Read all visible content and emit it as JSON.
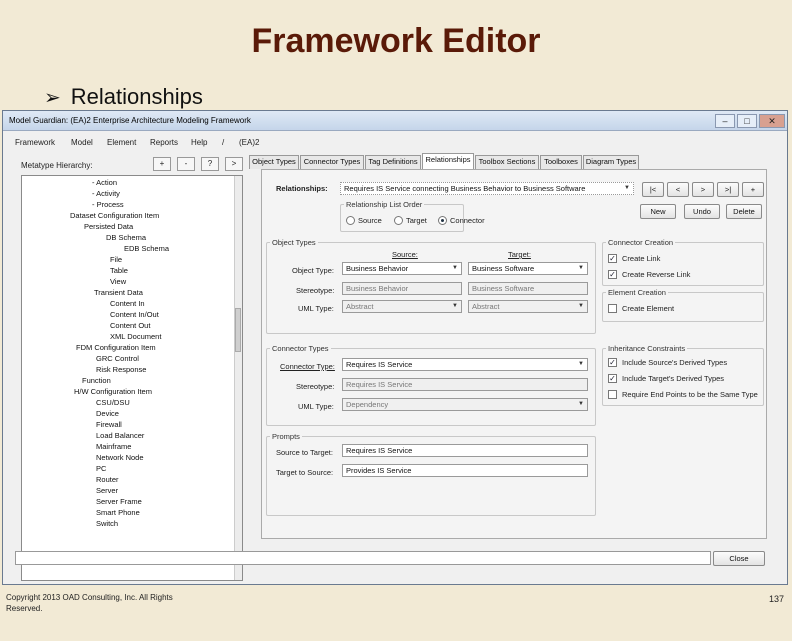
{
  "slide": {
    "title": "Framework Editor",
    "bullet": "Relationships",
    "copyright": "Copyright 2013 OAD Consulting, Inc. All Rights Reserved.",
    "page_number": "137"
  },
  "window": {
    "title": "Model Guardian: (EA)2 Enterprise Architecture Modeling Framework",
    "min": "–",
    "max": "□",
    "close": "✕"
  },
  "menu": [
    "Framework",
    "Model",
    "Element",
    "Reports",
    "Help",
    "/",
    "(EA)2"
  ],
  "left": {
    "hierarchy_label": "Metatype Hierarchy:",
    "buttons": [
      "+",
      "-",
      "?",
      ">"
    ],
    "tree": [
      "- Action",
      "- Activity",
      "- Process",
      "Dataset Configuration Item",
      "Persisted Data",
      "DB Schema",
      "EDB Schema",
      "File",
      "Table",
      "View",
      "Transient Data",
      "Content In",
      "Content In/Out",
      "Content Out",
      "XML Document",
      "FDM Configuration Item",
      "GRC Control",
      "Risk Response",
      "Function",
      "H/W Configuration Item",
      "CSU/DSU",
      "Device",
      "Firewall",
      "Load Balancer",
      "Mainframe",
      "Network Node",
      "PC",
      "Router",
      "Server",
      "Server Frame",
      "Smart Phone",
      "Switch"
    ]
  },
  "tabs": [
    "Object Types",
    "Connector Types",
    "Tag Definitions",
    "Relationships",
    "Toolbox Sections",
    "Toolboxes",
    "Diagram Types"
  ],
  "relationships": {
    "label": "Relationships:",
    "value": "Requires IS Service connecting Business Behavior to Business Software",
    "nav": [
      "|<",
      "<",
      ">",
      ">|",
      "+"
    ],
    "list_order_title": "Relationship List Order",
    "order_options": [
      "Source",
      "Target",
      "Connector"
    ],
    "new": "New",
    "undo": "Undo",
    "delete": "Delete"
  },
  "object_types": {
    "title": "Object Types",
    "source_header": "Source:",
    "target_header": "Target:",
    "object_type_label": "Object Type:",
    "stereotype_label": "Stereotype:",
    "uml_type_label": "UML Type:",
    "source_object_type": "Business Behavior",
    "target_object_type": "Business Software",
    "source_stereotype": "Business Behavior",
    "target_stereotype": "Business Software",
    "source_uml": "Abstract",
    "target_uml": "Abstract"
  },
  "connector_creation": {
    "title": "Connector Creation",
    "create_link": "Create Link",
    "create_reverse_link": "Create Reverse Link"
  },
  "element_creation": {
    "title": "Element Creation",
    "create_element": "Create Element"
  },
  "connector_types": {
    "title": "Connector Types",
    "connector_type_label": "Connector Type:",
    "stereotype_label": "Stereotype:",
    "uml_type_label": "UML Type:",
    "connector_type": "Requires IS Service",
    "stereotype": "Requires IS Service",
    "uml_type": "Dependency"
  },
  "inheritance": {
    "title": "Inheritance Constraints",
    "include_source": "Include Source's Derived Types",
    "include_target": "Include Target's Derived Types",
    "require_end": "Require End Points to be the Same Type"
  },
  "prompts": {
    "title": "Prompts",
    "source_to_target_label": "Source to Target:",
    "target_to_source_label": "Target to Source:",
    "source_to_target": "Requires IS Service",
    "target_to_source": "Provides IS Service"
  },
  "close": "Close"
}
